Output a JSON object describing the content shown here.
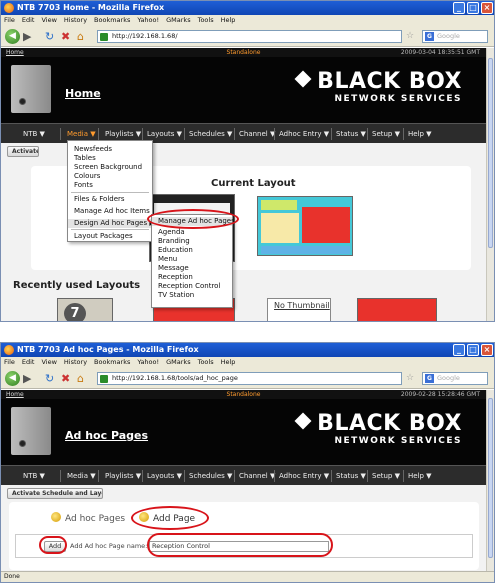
{
  "shot1": {
    "window_title": "NTB 7703 Home - Mozilla Firefox",
    "menu": [
      "File",
      "Edit",
      "View",
      "History",
      "Bookmarks",
      "Yahoo!",
      "GMarks",
      "Tools",
      "Help"
    ],
    "url": "http://192.168.1.68/",
    "search_placeholder": "Google",
    "home_link": "Home",
    "mode_label": "Standalone",
    "clock": "2009-03-04 18:35:51 GMT",
    "page_heading": "Home",
    "brand_name": "BLACK BOX",
    "brand_tagline": "NETWORK SERVICES",
    "nav_menu": [
      "NTB ▼",
      "Media ▼",
      "Playlists ▼",
      "Layouts ▼",
      "Schedules ▼",
      "Channel ▼",
      "Adhoc Entry ▼",
      "Status ▼",
      "Setup ▼",
      "Help ▼"
    ],
    "activate_label": "Activate Schedule and Layouts",
    "current_layout_title": "Current Layout",
    "recently_used_title": "Recently used Layouts",
    "no_thumbnail": "No Thumbnail",
    "thumb_number": "7",
    "media_dropdown": {
      "group1": [
        "Newsfeeds",
        "Tables",
        "Screen Background",
        "Colours",
        "Fonts"
      ],
      "group2": [
        "Files & Folders",
        "Manage Ad hoc Items",
        "Design Ad hoc Pages ▶"
      ],
      "group3": [
        "Layout Packages"
      ]
    },
    "submenu": {
      "highlight": "Manage Ad hoc Pages",
      "items": [
        "Agenda",
        "Branding",
        "Education",
        "Menu",
        "Message",
        "Reception",
        "Reception Control",
        "TV Station"
      ]
    }
  },
  "shot2": {
    "window_title": "NTB 7703 Ad hoc Pages - Mozilla Firefox",
    "menu": [
      "File",
      "Edit",
      "View",
      "History",
      "Bookmarks",
      "Yahoo!",
      "GMarks",
      "Tools",
      "Help"
    ],
    "url": "http://192.168.1.68/tools/ad_hoc_page",
    "search_placeholder": "Google",
    "home_link": "Home",
    "mode_label": "Standalone",
    "clock": "2009-02-28 15:28:46 GMT",
    "page_heading": "Ad hoc Pages",
    "brand_name": "BLACK BOX",
    "brand_tagline": "NETWORK SERVICES",
    "nav_menu": [
      "NTB ▼",
      "Media ▼",
      "Playlists ▼",
      "Layouts ▼",
      "Schedules ▼",
      "Channel ▼",
      "Adhoc Entry ▼",
      "Status ▼",
      "Setup ▼",
      "Help ▼"
    ],
    "activate_label": "Activate Schedule and Layouts",
    "tab_list": "Ad hoc Pages",
    "tab_add": "Add Page",
    "add_button": "Add",
    "field_label": "Add Ad hoc Page name:",
    "field_value": "Reception Control",
    "status_text": "Done"
  },
  "colors": {
    "accent": "#ff9b2e",
    "highlight_ring": "#d8141a",
    "preview_red": "#e8322c",
    "preview_cyan": "#44c8d8"
  }
}
